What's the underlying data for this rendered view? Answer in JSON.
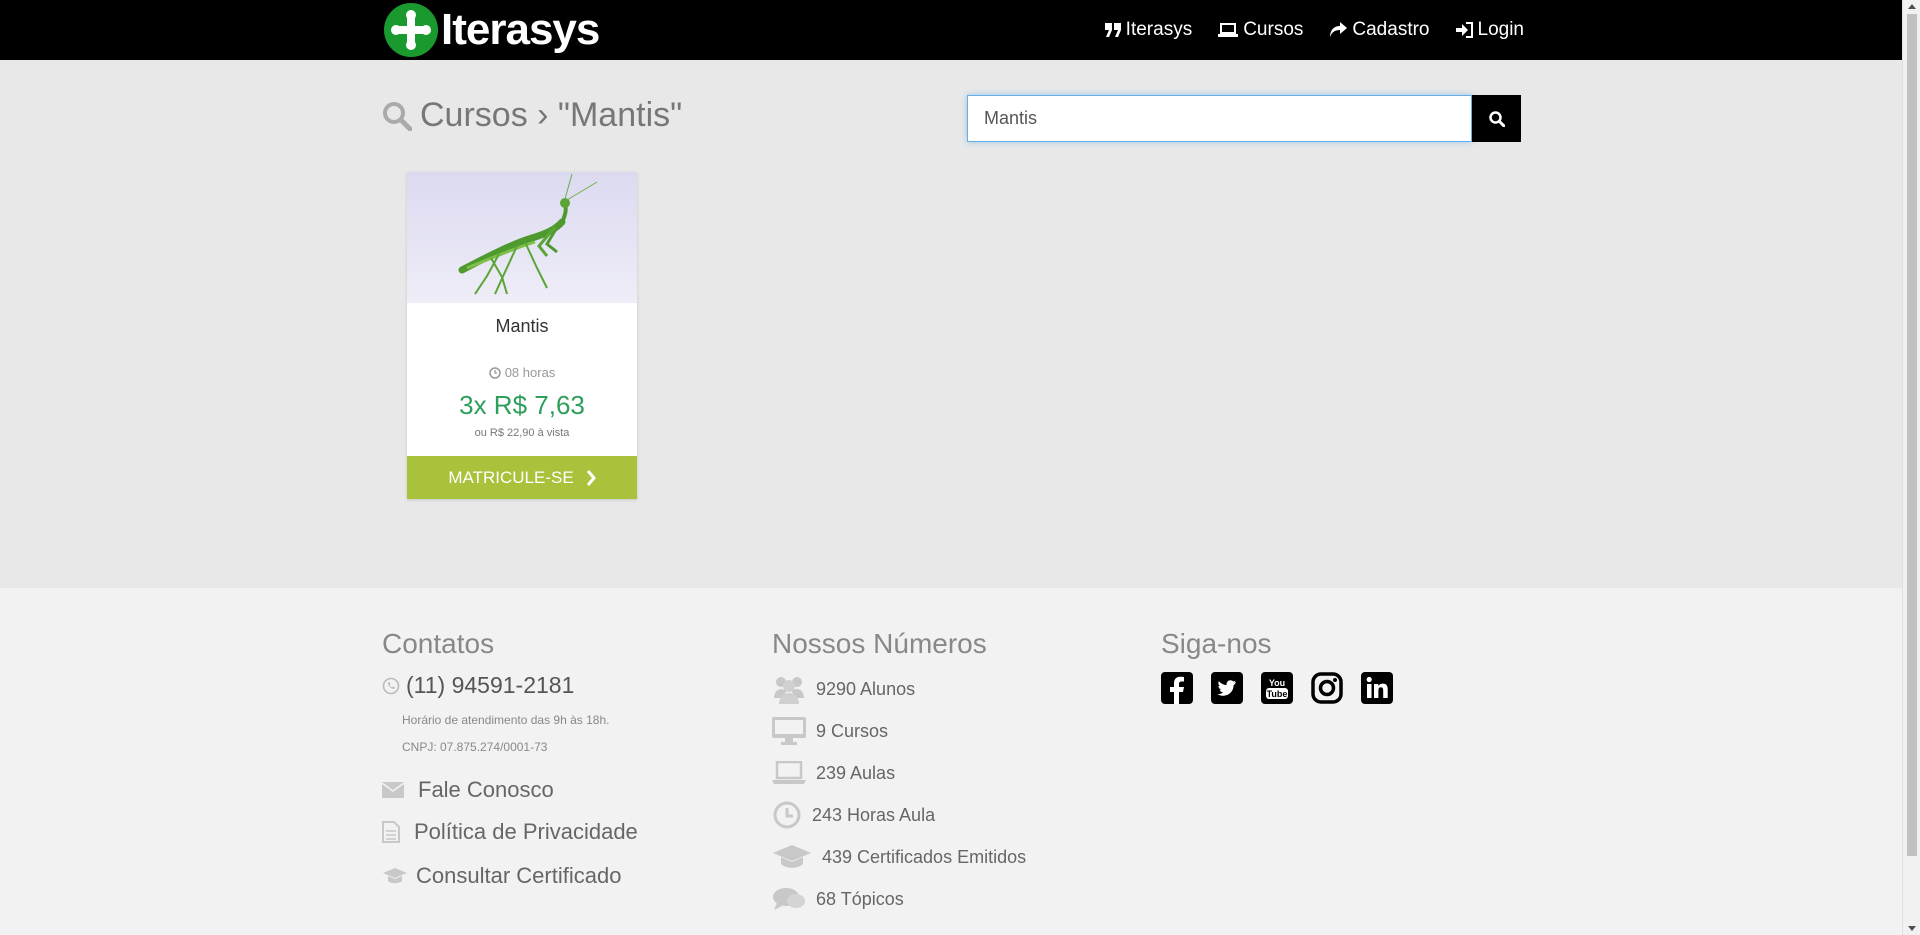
{
  "navbar": {
    "brand": "Iterasys",
    "items": [
      {
        "label": "Iterasys",
        "icon": "quote-icon"
      },
      {
        "label": "Cursos",
        "icon": "laptop-icon"
      },
      {
        "label": "Cadastro",
        "icon": "share-icon"
      },
      {
        "label": "Login",
        "icon": "sign-in-icon"
      }
    ]
  },
  "main": {
    "breadcrumb": "Cursos › \"Mantis\"",
    "search": {
      "value": "Mantis",
      "placeholder": ""
    }
  },
  "course": {
    "title": "Mantis",
    "hours": "08 horas",
    "price": "3x R$ 7,63",
    "cash_price": "ou R$ 22,90 à vista",
    "button": "MATRICULE-SE"
  },
  "footer": {
    "contacts": {
      "title": "Contatos",
      "phone": "(11) 94591-2181",
      "hours": "Horário de atendimento das 9h às 18h.",
      "cnpj": "CNPJ: 07.875.274/0001-73",
      "links": [
        "Fale Conosco",
        "Política de Privacidade",
        "Consultar Certificado"
      ]
    },
    "numbers": {
      "title": "Nossos Números",
      "stats": [
        "9290 Alunos",
        "9 Cursos",
        "239 Aulas",
        "243 Horas Aula",
        "439 Certificados Emitidos",
        "68 Tópicos"
      ]
    },
    "social": {
      "title": "Siga-nos",
      "icons": [
        "facebook-icon",
        "twitter-icon",
        "youtube-icon",
        "instagram-icon",
        "linkedin-icon"
      ]
    }
  },
  "colors": {
    "navbar": "#000000",
    "accent_green": "#a8c23b",
    "price_green": "#2e9e5b",
    "logo_green": "#1a9a2e"
  }
}
